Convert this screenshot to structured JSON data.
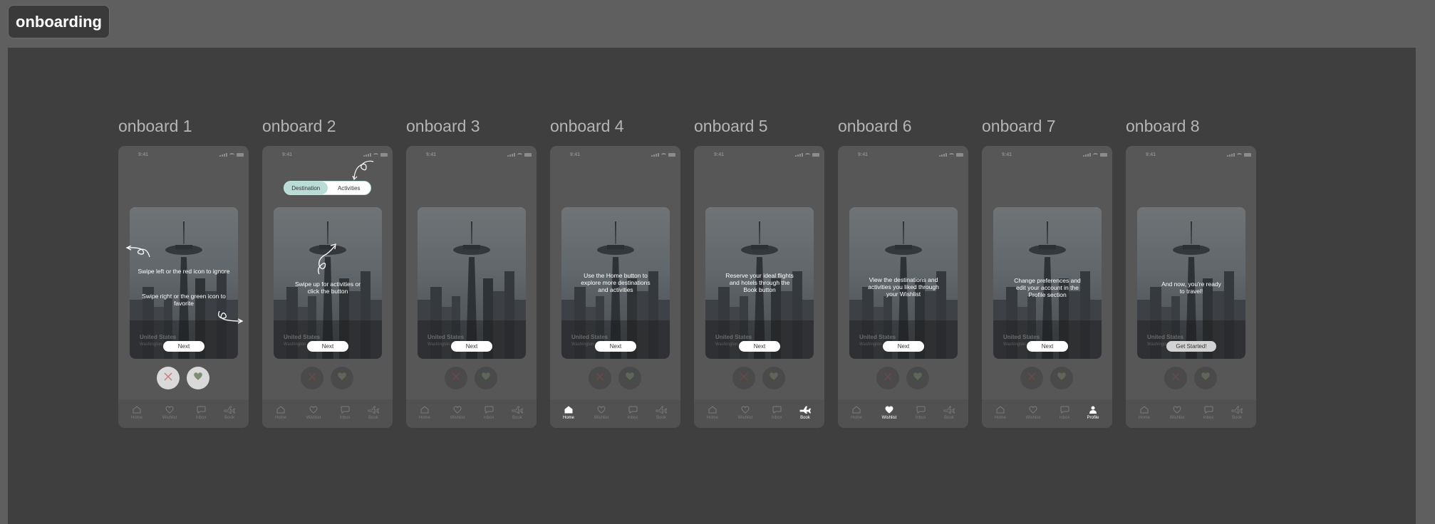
{
  "page": {
    "title": "onboarding"
  },
  "colors": {
    "accent": "#b9ddd6",
    "reject": "#c97070",
    "like": "#7c8f76"
  },
  "status_time": "9:41",
  "card": {
    "country": "United States",
    "city": "Washington"
  },
  "tabs": [
    "Home",
    "Wishlist",
    "Inbox",
    "Book"
  ],
  "toggle": {
    "left": "Destination",
    "right": "Activities"
  },
  "frames": [
    {
      "label": "onboard 1",
      "button": "Next",
      "text_a": "Swipe left or the red icon to ignore",
      "text_b": "Swipe right or the green icon to favorite"
    },
    {
      "label": "onboard 2",
      "button": "Next",
      "text_a": "Swipe up for activities or click the button"
    },
    {
      "label": "onboard 3",
      "button": "Next"
    },
    {
      "label": "onboard 4",
      "button": "Next",
      "text_a": "Use the Home button to explore more destinations and activities"
    },
    {
      "label": "onboard 5",
      "button": "Next",
      "text_a": "Reserve your ideal flights and hotels through the Book button"
    },
    {
      "label": "onboard 6",
      "button": "Next",
      "text_a": "View the destinations and activities you liked through your Wishlist"
    },
    {
      "label": "onboard 7",
      "button": "Next",
      "text_a": "Change preferences and edit your account in the Profile section",
      "tab_override": "Profile"
    },
    {
      "label": "onboard 8",
      "button": "Get Started!",
      "text_a": "And now, you're ready to travel!"
    }
  ]
}
